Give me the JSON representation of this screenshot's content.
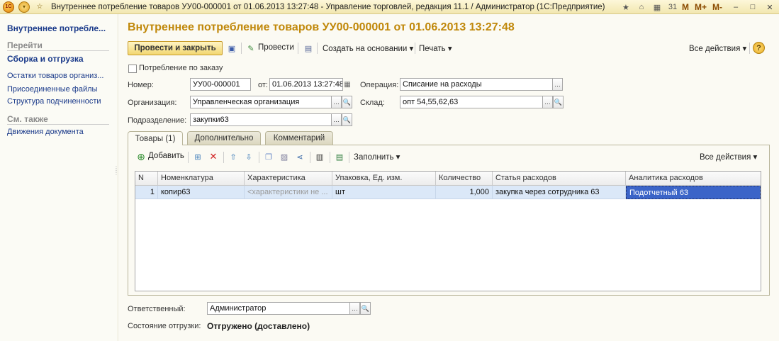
{
  "window": {
    "title": "Внутреннее потребление товаров УУ00-000001 от 01.06.2013 13:27:48 - Управление торговлей, редакция 11.1 / Администратор   (1С:Предприятие)",
    "m_labels": [
      "M",
      "M+",
      "M-"
    ]
  },
  "sidebar": {
    "title": "Внутреннее потребле...",
    "goto_label": "Перейти",
    "goto_items": [
      "Сборка и отгрузка",
      "Остатки товаров организ...",
      "Присоединенные файлы",
      "Структура подчиненности"
    ],
    "see_also_label": "См. также",
    "see_also_items": [
      "Движения документа"
    ]
  },
  "document": {
    "title": "Внутреннее потребление товаров УУ00-000001 от 01.06.2013 13:27:48"
  },
  "toolbar": {
    "post_close": "Провести и закрыть",
    "post": "Провести",
    "create_based": "Создать на основании",
    "print": "Печать",
    "all_actions": "Все действия",
    "help": "?"
  },
  "form": {
    "consumption_by_order": "Потребление по заказу",
    "number_label": "Номер:",
    "number_value": "УУ00-000001",
    "date_label": "от:",
    "date_value": "01.06.2013 13:27:48",
    "operation_label": "Операция:",
    "operation_value": "Списание на расходы",
    "org_label": "Организация:",
    "org_value": "Управленческая организация",
    "warehouse_label": "Склад:",
    "warehouse_value": "опт 54,55,62,63",
    "division_label": "Подразделение:",
    "division_value": "закупки63",
    "responsible_label": "Ответственный:",
    "responsible_value": "Администратор",
    "shipment_status_label": "Состояние отгрузки:",
    "shipment_status_value": "Отгружено (доставлено)"
  },
  "tabs": [
    {
      "label": "Товары (1)"
    },
    {
      "label": "Дополнительно"
    },
    {
      "label": "Комментарий"
    }
  ],
  "goods_toolbar": {
    "add": "Добавить",
    "fill": "Заполнить",
    "all_actions": "Все действия"
  },
  "table": {
    "columns": [
      "N",
      "Номенклатура",
      "Характеристика",
      "Упаковка, Ед. изм.",
      "Количество",
      "Статья расходов",
      "Аналитика расходов"
    ],
    "rows": [
      [
        "1",
        "копир63",
        "<характеристики не ...",
        "шт",
        "1,000",
        "закупка через сотрудника 63",
        "Подотчетный 63"
      ]
    ]
  },
  "colors": {
    "title_gold": "#c0880a",
    "link_blue": "#1a3a8a",
    "row_selected": "#dbe8f8",
    "cell_focus": "#3b64c8"
  }
}
